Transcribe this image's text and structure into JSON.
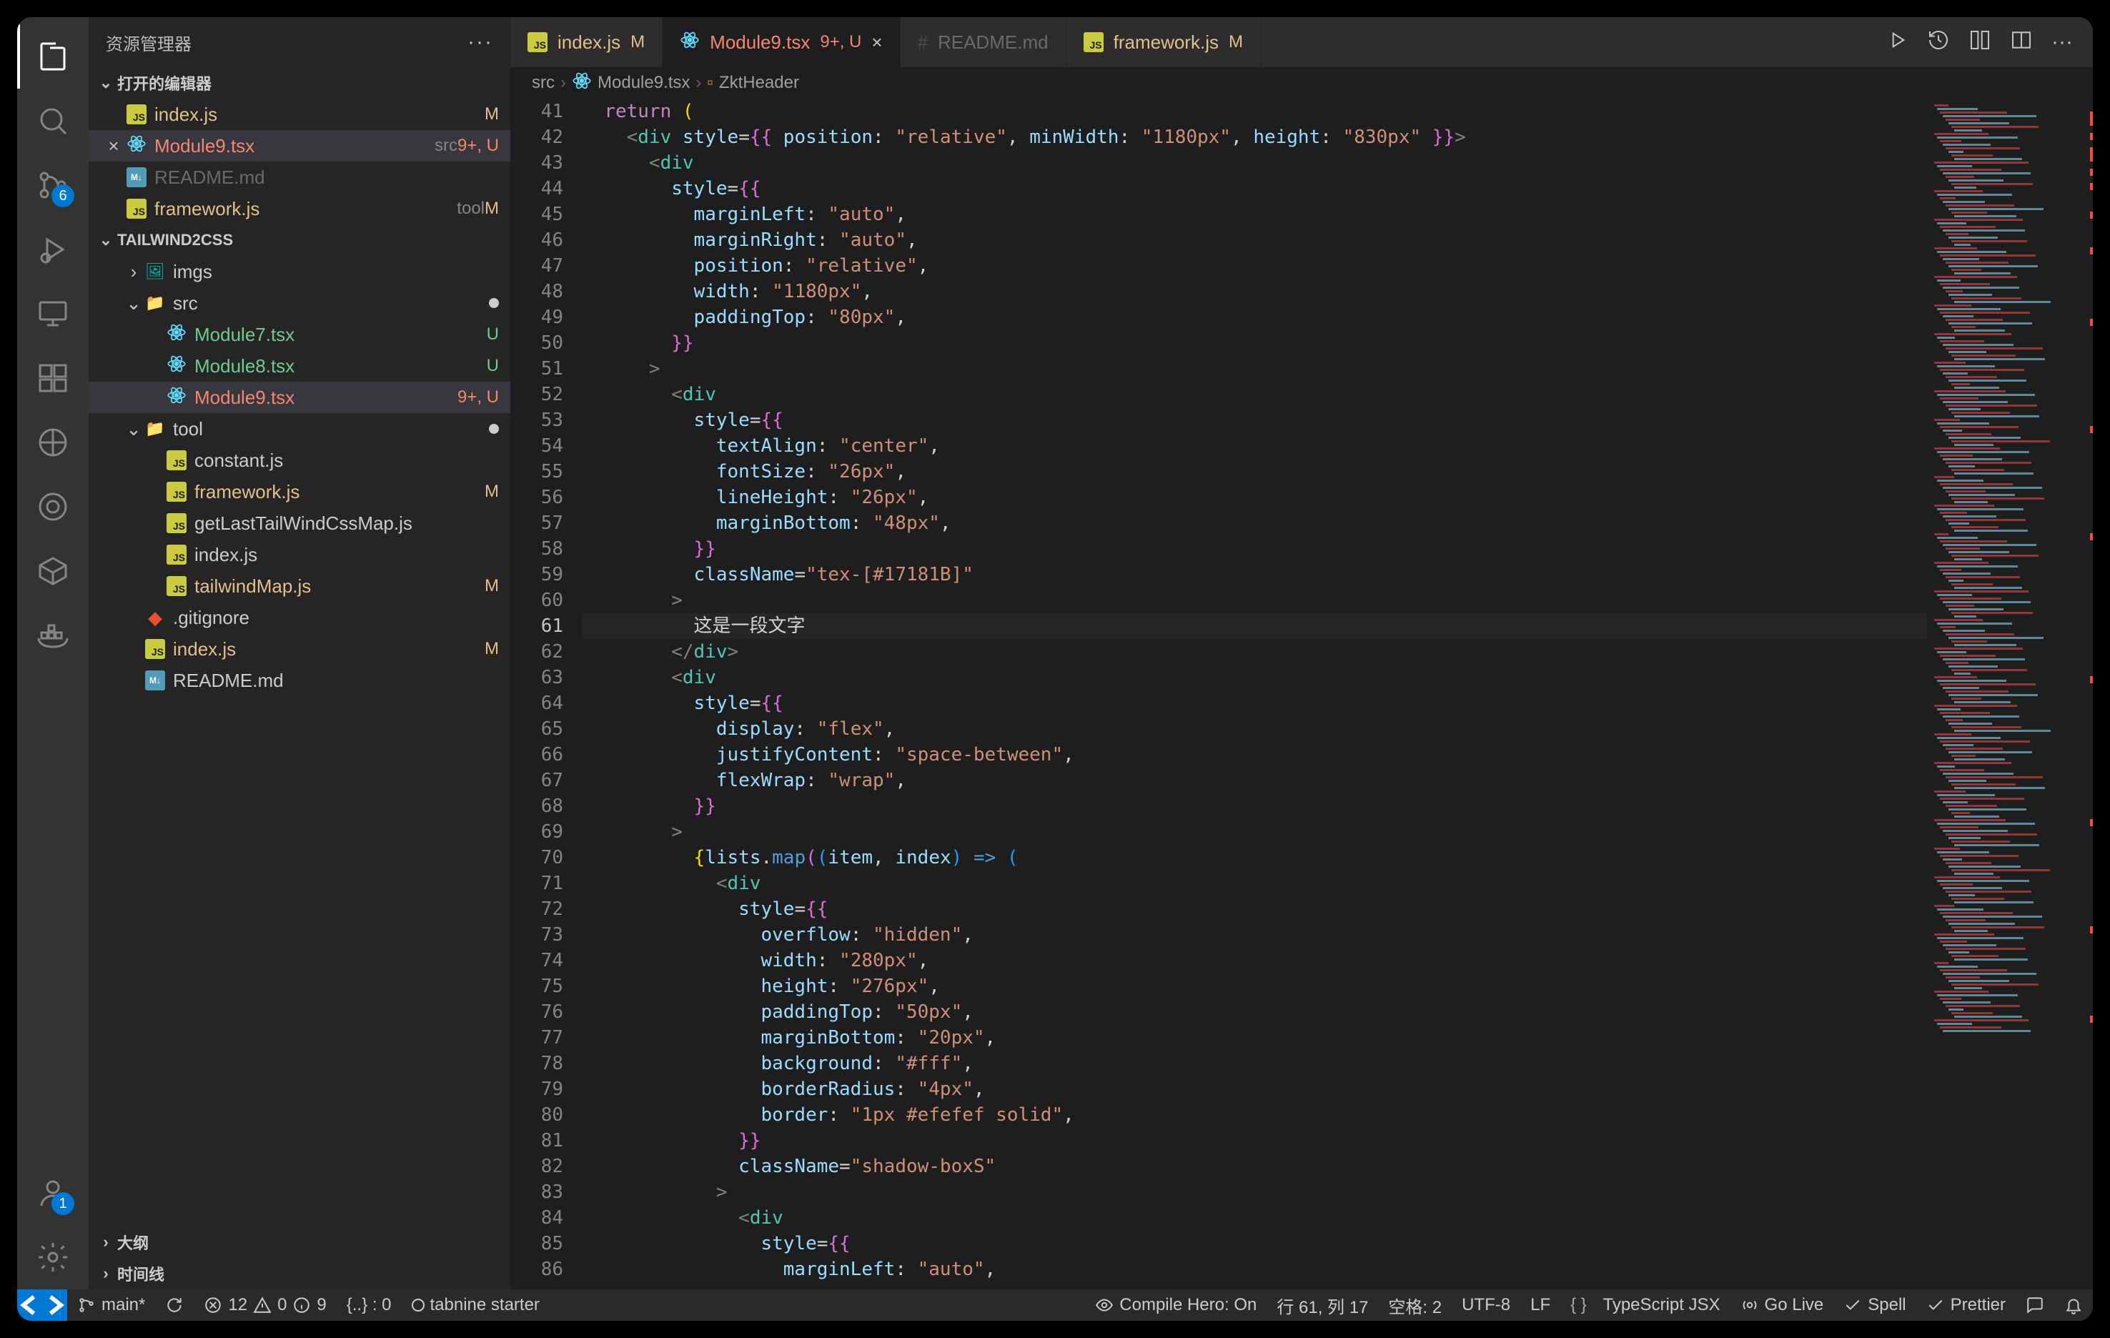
{
  "sidebar": {
    "title": "资源管理器",
    "sections": {
      "openEditors": {
        "title": "打开的编辑器",
        "items": [
          {
            "icon": "js",
            "name": "index.js",
            "badge": "M",
            "badgeClass": "c-m",
            "labelClass": "c-m"
          },
          {
            "icon": "react",
            "name": "Module9.tsx",
            "suffix": "src",
            "badge": "9+, U",
            "badgeClass": "c-err",
            "labelClass": "c-err",
            "closable": true,
            "selected": true
          },
          {
            "icon": "md",
            "name": "README.md",
            "labelClass": "c-dim"
          },
          {
            "icon": "js",
            "name": "framework.js",
            "suffix": "tool",
            "badge": "M",
            "badgeClass": "c-m",
            "labelClass": "c-m"
          }
        ]
      },
      "workspace": {
        "title": "TAILWIND2CSS",
        "tree": [
          {
            "depth": 1,
            "chev": "right",
            "icon": "folder-img",
            "name": "imgs"
          },
          {
            "depth": 1,
            "chev": "down",
            "icon": "folder-g",
            "name": "src",
            "dotBadge": true
          },
          {
            "depth": 2,
            "icon": "react",
            "name": "Module7.tsx",
            "badge": "U",
            "badgeClass": "c-u",
            "labelClass": "c-u"
          },
          {
            "depth": 2,
            "icon": "react",
            "name": "Module8.tsx",
            "badge": "U",
            "badgeClass": "c-u",
            "labelClass": "c-u"
          },
          {
            "depth": 2,
            "icon": "react",
            "name": "Module9.tsx",
            "badge": "9+, U",
            "badgeClass": "c-err",
            "labelClass": "c-err",
            "selected": true
          },
          {
            "depth": 1,
            "chev": "down",
            "icon": "folder-o",
            "name": "tool",
            "dotBadge": true
          },
          {
            "depth": 2,
            "icon": "js",
            "name": "constant.js"
          },
          {
            "depth": 2,
            "icon": "js",
            "name": "framework.js",
            "badge": "M",
            "badgeClass": "c-m",
            "labelClass": "c-m"
          },
          {
            "depth": 2,
            "icon": "js",
            "name": "getLastTailWindCssMap.js"
          },
          {
            "depth": 2,
            "icon": "js",
            "name": "index.js"
          },
          {
            "depth": 2,
            "icon": "js",
            "name": "tailwindMap.js",
            "badge": "M",
            "badgeClass": "c-m",
            "labelClass": "c-m"
          },
          {
            "depth": 1,
            "icon": "git",
            "name": ".gitignore"
          },
          {
            "depth": 1,
            "icon": "js",
            "name": "index.js",
            "badge": "M",
            "badgeClass": "c-m",
            "labelClass": "c-m"
          },
          {
            "depth": 1,
            "icon": "md",
            "name": "README.md"
          }
        ]
      },
      "outline": {
        "title": "大纲"
      },
      "timeline": {
        "title": "时间线"
      }
    }
  },
  "activity": {
    "scmBadge": "6",
    "accountBadge": "1"
  },
  "tabs": [
    {
      "icon": "js",
      "label": "index.js",
      "suffix": "M",
      "suffixClass": "c-m",
      "labelClass": "c-m"
    },
    {
      "icon": "react",
      "label": "Module9.tsx",
      "suffix": "9+, U",
      "suffixClass": "c-err",
      "labelClass": "c-err",
      "active": true,
      "closable": true
    },
    {
      "icon": "hash",
      "label": "README.md",
      "dim": true
    },
    {
      "icon": "js",
      "label": "framework.js",
      "suffix": "M",
      "suffixClass": "c-m",
      "labelClass": "c-m"
    }
  ],
  "breadcrumb": {
    "parts": [
      "src",
      "Module9.tsx",
      "ZktHeader"
    ]
  },
  "editor": {
    "startLine": 41,
    "activeLine": 61,
    "lines": [
      [
        [
          "  ",
          "p"
        ],
        [
          "return ",
          "kw"
        ],
        [
          "(",
          "br1"
        ]
      ],
      [
        [
          "    ",
          "p"
        ],
        [
          "<",
          "tag"
        ],
        [
          "div",
          "name"
        ],
        [
          " ",
          "p"
        ],
        [
          "style",
          "attr"
        ],
        [
          "=",
          "p"
        ],
        [
          "{{",
          "br2"
        ],
        [
          " position",
          "attr"
        ],
        [
          ": ",
          "p"
        ],
        [
          "\"relative\"",
          "str"
        ],
        [
          ", ",
          "p"
        ],
        [
          "minWidth",
          "attr"
        ],
        [
          ": ",
          "p"
        ],
        [
          "\"1180px\"",
          "str"
        ],
        [
          ", ",
          "p"
        ],
        [
          "height",
          "attr"
        ],
        [
          ": ",
          "p"
        ],
        [
          "\"830px\"",
          "str"
        ],
        [
          " ",
          "p"
        ],
        [
          "}}",
          "br2"
        ],
        [
          ">",
          "tag"
        ]
      ],
      [
        [
          "      ",
          "p"
        ],
        [
          "<",
          "tag"
        ],
        [
          "div",
          "name"
        ]
      ],
      [
        [
          "        ",
          "p"
        ],
        [
          "style",
          "attr"
        ],
        [
          "=",
          "p"
        ],
        [
          "{{",
          "br2"
        ]
      ],
      [
        [
          "          ",
          "p"
        ],
        [
          "marginLeft",
          "attr"
        ],
        [
          ": ",
          "p"
        ],
        [
          "\"auto\"",
          "str"
        ],
        [
          ",",
          "p"
        ]
      ],
      [
        [
          "          ",
          "p"
        ],
        [
          "marginRight",
          "attr"
        ],
        [
          ": ",
          "p"
        ],
        [
          "\"auto\"",
          "str"
        ],
        [
          ",",
          "p"
        ]
      ],
      [
        [
          "          ",
          "p"
        ],
        [
          "position",
          "attr"
        ],
        [
          ": ",
          "p"
        ],
        [
          "\"relative\"",
          "str"
        ],
        [
          ",",
          "p"
        ]
      ],
      [
        [
          "          ",
          "p"
        ],
        [
          "width",
          "attr"
        ],
        [
          ": ",
          "p"
        ],
        [
          "\"1180px\"",
          "str"
        ],
        [
          ",",
          "p"
        ]
      ],
      [
        [
          "          ",
          "p"
        ],
        [
          "paddingTop",
          "attr"
        ],
        [
          ": ",
          "p"
        ],
        [
          "\"80px\"",
          "str"
        ],
        [
          ",",
          "p"
        ]
      ],
      [
        [
          "        ",
          "p"
        ],
        [
          "}}",
          "br2"
        ]
      ],
      [
        [
          "      ",
          "p"
        ],
        [
          ">",
          "tag"
        ]
      ],
      [
        [
          "        ",
          "p"
        ],
        [
          "<",
          "tag"
        ],
        [
          "div",
          "name"
        ]
      ],
      [
        [
          "          ",
          "p"
        ],
        [
          "style",
          "attr"
        ],
        [
          "=",
          "p"
        ],
        [
          "{{",
          "br2"
        ]
      ],
      [
        [
          "            ",
          "p"
        ],
        [
          "textAlign",
          "attr"
        ],
        [
          ": ",
          "p"
        ],
        [
          "\"center\"",
          "str"
        ],
        [
          ",",
          "p"
        ]
      ],
      [
        [
          "            ",
          "p"
        ],
        [
          "fontSize",
          "attr"
        ],
        [
          ": ",
          "p"
        ],
        [
          "\"26px\"",
          "str"
        ],
        [
          ",",
          "p"
        ]
      ],
      [
        [
          "            ",
          "p"
        ],
        [
          "lineHeight",
          "attr"
        ],
        [
          ": ",
          "p"
        ],
        [
          "\"26px\"",
          "str"
        ],
        [
          ",",
          "p"
        ]
      ],
      [
        [
          "            ",
          "p"
        ],
        [
          "marginBottom",
          "attr"
        ],
        [
          ": ",
          "p"
        ],
        [
          "\"48px\"",
          "str"
        ],
        [
          ",",
          "p"
        ]
      ],
      [
        [
          "          ",
          "p"
        ],
        [
          "}}",
          "br2"
        ]
      ],
      [
        [
          "          ",
          "p"
        ],
        [
          "className",
          "attr"
        ],
        [
          "=",
          "p"
        ],
        [
          "\"tex-[#17181B]\"",
          "str"
        ]
      ],
      [
        [
          "        ",
          "p"
        ],
        [
          ">",
          "tag"
        ]
      ],
      [
        [
          "          这是一段文字",
          "txt"
        ]
      ],
      [
        [
          "        ",
          "p"
        ],
        [
          "</",
          "tag"
        ],
        [
          "div",
          "name"
        ],
        [
          ">",
          "tag"
        ]
      ],
      [
        [
          "        ",
          "p"
        ],
        [
          "<",
          "tag"
        ],
        [
          "div",
          "name"
        ]
      ],
      [
        [
          "          ",
          "p"
        ],
        [
          "style",
          "attr"
        ],
        [
          "=",
          "p"
        ],
        [
          "{{",
          "br2"
        ]
      ],
      [
        [
          "            ",
          "p"
        ],
        [
          "display",
          "attr"
        ],
        [
          ": ",
          "p"
        ],
        [
          "\"flex\"",
          "str"
        ],
        [
          ",",
          "p"
        ]
      ],
      [
        [
          "            ",
          "p"
        ],
        [
          "justifyContent",
          "attr"
        ],
        [
          ": ",
          "p"
        ],
        [
          "\"space-between\"",
          "str"
        ],
        [
          ",",
          "p"
        ]
      ],
      [
        [
          "            ",
          "p"
        ],
        [
          "flexWrap",
          "attr"
        ],
        [
          ": ",
          "p"
        ],
        [
          "\"wrap\"",
          "str"
        ],
        [
          ",",
          "p"
        ]
      ],
      [
        [
          "          ",
          "p"
        ],
        [
          "}}",
          "br2"
        ]
      ],
      [
        [
          "        ",
          "p"
        ],
        [
          ">",
          "tag"
        ]
      ],
      [
        [
          "          ",
          "p"
        ],
        [
          "{",
          "br1"
        ],
        [
          "lists",
          "attr"
        ],
        [
          ".",
          "p"
        ],
        [
          "map",
          "cls"
        ],
        [
          "(",
          "br2"
        ],
        [
          "(",
          "br3"
        ],
        [
          "item",
          "attr"
        ],
        [
          ", ",
          "p"
        ],
        [
          "index",
          "attr"
        ],
        [
          ")",
          "br3"
        ],
        [
          " => ",
          "op"
        ],
        [
          "(",
          "br3"
        ]
      ],
      [
        [
          "            ",
          "p"
        ],
        [
          "<",
          "tag"
        ],
        [
          "div",
          "name"
        ]
      ],
      [
        [
          "              ",
          "p"
        ],
        [
          "style",
          "attr"
        ],
        [
          "=",
          "p"
        ],
        [
          "{{",
          "br2"
        ]
      ],
      [
        [
          "                ",
          "p"
        ],
        [
          "overflow",
          "attr"
        ],
        [
          ": ",
          "p"
        ],
        [
          "\"hidden\"",
          "str"
        ],
        [
          ",",
          "p"
        ]
      ],
      [
        [
          "                ",
          "p"
        ],
        [
          "width",
          "attr"
        ],
        [
          ": ",
          "p"
        ],
        [
          "\"280px\"",
          "str"
        ],
        [
          ",",
          "p"
        ]
      ],
      [
        [
          "                ",
          "p"
        ],
        [
          "height",
          "attr"
        ],
        [
          ": ",
          "p"
        ],
        [
          "\"276px\"",
          "str"
        ],
        [
          ",",
          "p"
        ]
      ],
      [
        [
          "                ",
          "p"
        ],
        [
          "paddingTop",
          "attr"
        ],
        [
          ": ",
          "p"
        ],
        [
          "\"50px\"",
          "str"
        ],
        [
          ",",
          "p"
        ]
      ],
      [
        [
          "                ",
          "p"
        ],
        [
          "marginBottom",
          "attr"
        ],
        [
          ": ",
          "p"
        ],
        [
          "\"20px\"",
          "str"
        ],
        [
          ",",
          "p"
        ]
      ],
      [
        [
          "                ",
          "p"
        ],
        [
          "background",
          "attr"
        ],
        [
          ": ",
          "p"
        ],
        [
          "\"#fff\"",
          "str"
        ],
        [
          ",",
          "p"
        ]
      ],
      [
        [
          "                ",
          "p"
        ],
        [
          "borderRadius",
          "attr"
        ],
        [
          ": ",
          "p"
        ],
        [
          "\"4px\"",
          "str"
        ],
        [
          ",",
          "p"
        ]
      ],
      [
        [
          "                ",
          "p"
        ],
        [
          "border",
          "attr"
        ],
        [
          ": ",
          "p"
        ],
        [
          "\"1px #efefef solid\"",
          "str"
        ],
        [
          ",",
          "p"
        ]
      ],
      [
        [
          "              ",
          "p"
        ],
        [
          "}}",
          "br2"
        ]
      ],
      [
        [
          "              ",
          "p"
        ],
        [
          "className",
          "attr"
        ],
        [
          "=",
          "p"
        ],
        [
          "\"shadow-boxS\"",
          "str"
        ]
      ],
      [
        [
          "            ",
          "p"
        ],
        [
          ">",
          "tag"
        ]
      ],
      [
        [
          "              ",
          "p"
        ],
        [
          "<",
          "tag"
        ],
        [
          "div",
          "name"
        ]
      ],
      [
        [
          "                ",
          "p"
        ],
        [
          "style",
          "attr"
        ],
        [
          "=",
          "p"
        ],
        [
          "{{",
          "br2"
        ]
      ],
      [
        [
          "                  ",
          "p"
        ],
        [
          "marginLeft",
          "attr"
        ],
        [
          ": ",
          "p"
        ],
        [
          "\"auto\"",
          "str"
        ],
        [
          ",",
          "p"
        ]
      ]
    ]
  },
  "statusbar": {
    "branch": "main*",
    "errors": "12",
    "warnings": "0",
    "info": "9",
    "bracket": "{..} : 0",
    "tabnine": "tabnine starter",
    "compileHero": "Compile Hero: On",
    "cursor": "行 61, 列 17",
    "spaces": "空格: 2",
    "encoding": "UTF-8",
    "eol": "LF",
    "lang": "TypeScript JSX",
    "golive": "Go Live",
    "spell": "Spell",
    "prettier": "Prettier"
  }
}
